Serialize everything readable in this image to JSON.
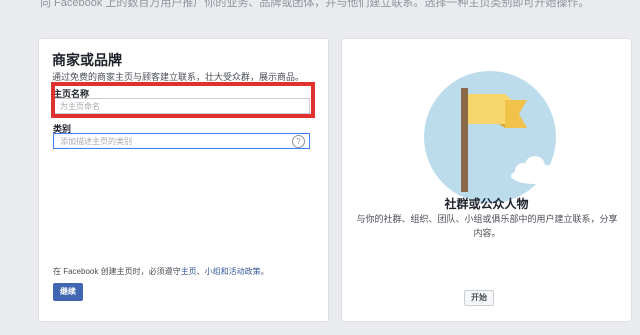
{
  "top_notice": "向 Facebook 上的数百万用户推广你的业务、品牌或团体，并与他们建立联系。选择一种主页类别即可开始操作。",
  "business_card": {
    "title": "商家或品牌",
    "description": "通过免费的商家主页与顾客建立联系，壮大受众群，展示商品。",
    "name_label": "主页名称",
    "name_placeholder": "为主页命名",
    "category_label": "类别",
    "category_placeholder": "添加描述主页的类别",
    "help_icon": "?",
    "terms_prefix": "在 Facebook 创建主页时，必须遵守",
    "terms_link1": "主页",
    "terms_sep": "、",
    "terms_link2": "小组和活动政策",
    "terms_suffix": "。",
    "continue_label": "继续"
  },
  "community_card": {
    "title": "社群或公众人物",
    "description": "与你的社群、组织、团队、小组或俱乐部中的用户建立联系，分享内容。",
    "start_label": "开始"
  },
  "colors": {
    "background": "#e9ebee",
    "primary_button": "#4267b2",
    "highlight": "#e03131",
    "illustration_circle": "#bcdcec",
    "flag": "#f7d66b",
    "pole": "#8b6a4a"
  },
  "icons": {
    "help": "help-icon",
    "illustration": "flag-illustration"
  }
}
